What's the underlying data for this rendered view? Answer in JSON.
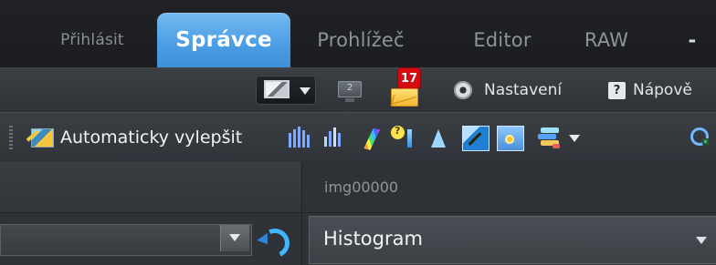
{
  "tabs": {
    "first": "Přihlásit",
    "active": "Správce",
    "second": "Prohlížeč",
    "third": "Editor",
    "fourth": "RAW",
    "fifth": "-"
  },
  "quick": {
    "badge": "17",
    "monitor_badge": "2",
    "settings": "Nastavení",
    "help": "Nápově",
    "help_icon": "?"
  },
  "toolbar": {
    "auto_enhance": "Automaticky vylepšit"
  },
  "panels": {
    "image_name": "img00000",
    "histogram": "Histogram"
  },
  "icons": {
    "screen": "screen-capture-icon",
    "monitor": "monitor-icon",
    "mail": "mail-icon",
    "settings": "gear-icon",
    "help": "help-icon",
    "auto_enhance": "auto-enhance-icon",
    "histogram": "histogram-icon",
    "color": "color-icon",
    "light": "lightbulb-icon",
    "sharpen": "sharpen-icon",
    "crop": "crop-icon",
    "save": "save-icon",
    "batch": "batch-icon",
    "refresh": "refresh-icon",
    "zoom": "zoom-icon"
  },
  "colors": {
    "active_tab": "#4b9ee4",
    "background": "#2b2d30",
    "badge": "#d40b11"
  }
}
